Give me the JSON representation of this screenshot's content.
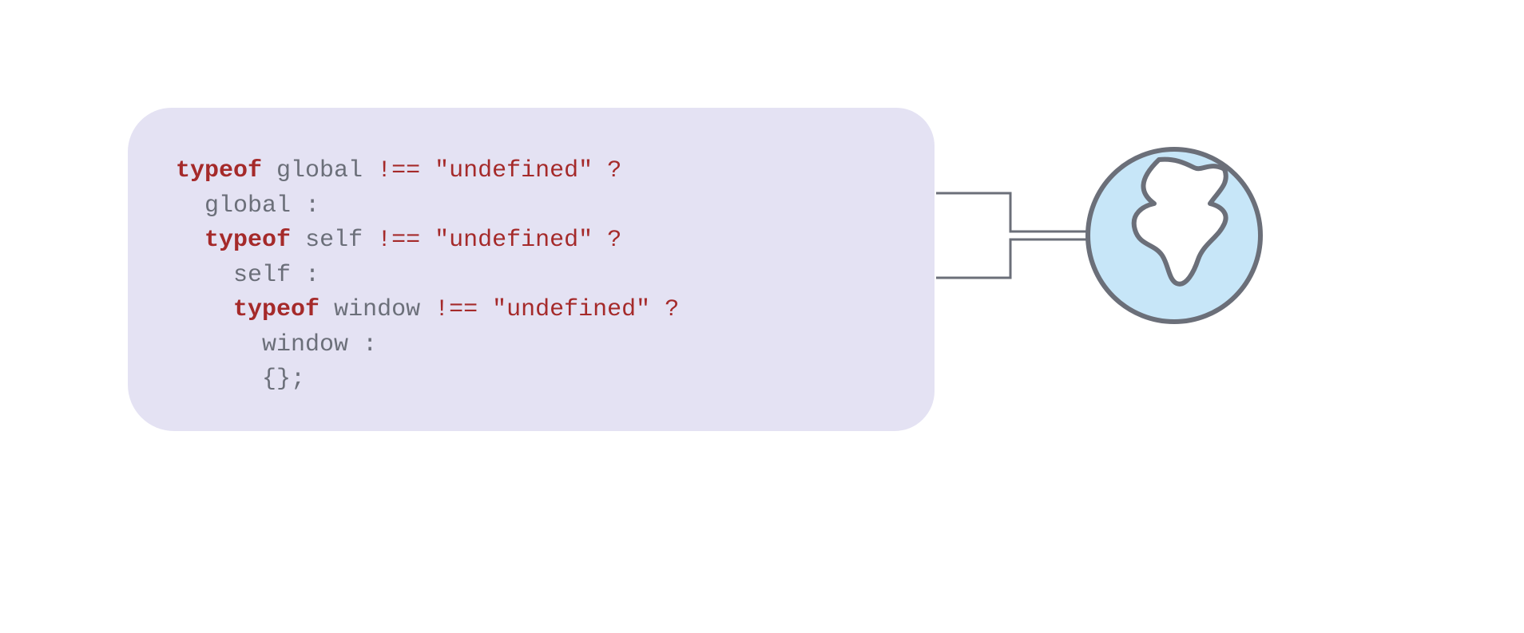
{
  "code": {
    "line1": {
      "kw": "typeof",
      "sp1": " ",
      "id": "global",
      "sp2": " ",
      "op": "!==",
      "sp3": " ",
      "str": "\"undefined\"",
      "sp4": " ",
      "q": "?"
    },
    "line2": {
      "indent": "  ",
      "id": "global",
      "sp": " ",
      "colon": ":"
    },
    "line3": {
      "indent": "  ",
      "kw": "typeof",
      "sp1": " ",
      "id": "self",
      "sp2": " ",
      "op": "!==",
      "sp3": " ",
      "str": "\"undefined\"",
      "sp4": " ",
      "q": "?"
    },
    "line4": {
      "indent": "    ",
      "id": "self",
      "sp": " ",
      "colon": ":"
    },
    "line5": {
      "indent": "    ",
      "kw": "typeof",
      "sp1": " ",
      "id": "window",
      "sp2": " ",
      "op": "!==",
      "sp3": " ",
      "str": "\"undefined\"",
      "sp4": " ",
      "q": "?"
    },
    "line6": {
      "indent": "      ",
      "id": "window",
      "sp": " ",
      "colon": ":"
    },
    "line7": {
      "indent": "      ",
      "braces": "{};"
    }
  },
  "colors": {
    "panel_bg": "#e4e2f3",
    "keyword": "#a52a2a",
    "text": "#6b6f79",
    "connector": "#6b6f79",
    "globe_fill": "#c7e6f8",
    "globe_stroke": "#6b6f79",
    "landmass_fill": "#ffffff"
  }
}
